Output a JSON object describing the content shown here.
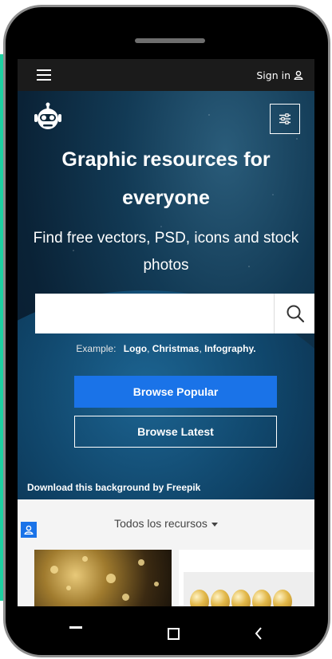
{
  "topbar": {
    "signin_label": "Sign in"
  },
  "hero": {
    "headline": "Graphic resources for everyone",
    "subline": "Find free vectors, PSD, icons and stock photos",
    "search": {
      "value": "",
      "placeholder": ""
    },
    "examples": {
      "label": "Example:",
      "tags": [
        "Logo",
        "Christmas",
        "Infography."
      ]
    },
    "buttons": {
      "popular": "Browse Popular",
      "latest": "Browse Latest"
    },
    "credit": "Download this background by Freepik"
  },
  "resources": {
    "dropdown_label": "Todos los recursos"
  },
  "icons": {
    "menu": "hamburger-menu-icon",
    "user": "user-icon",
    "logo": "robot-logo-icon",
    "filter": "sliders-icon",
    "search": "magnifier-icon",
    "caret": "caret-down-icon",
    "nav": [
      "recent-apps-icon",
      "home-icon",
      "back-icon"
    ]
  },
  "colors": {
    "accent": "#1a73e8",
    "teal": "#1dd1a1",
    "topbar": "#1b1b1b"
  }
}
